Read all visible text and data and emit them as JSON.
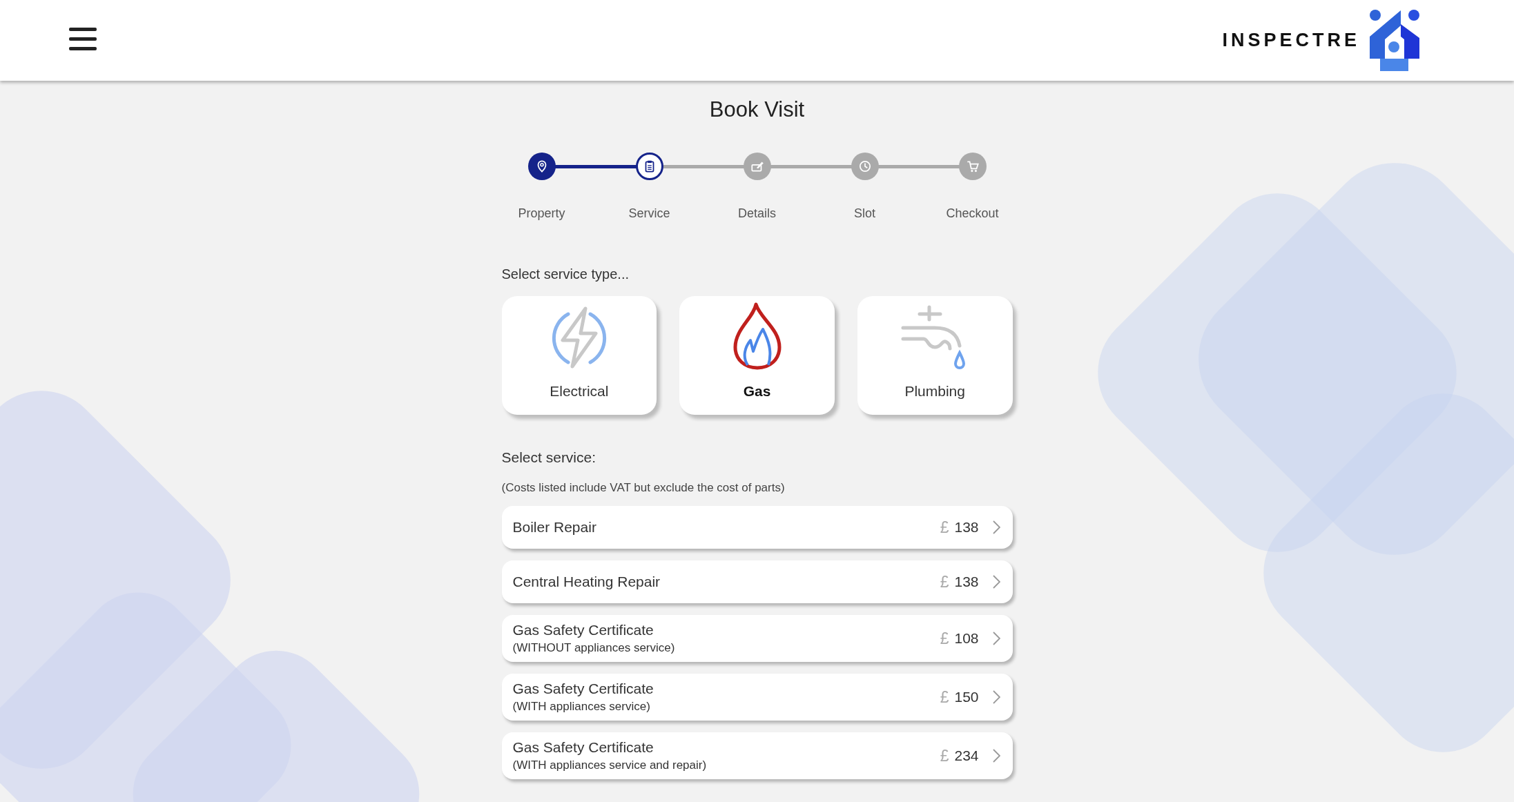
{
  "header": {
    "logo_text": "INSPECTRE"
  },
  "page_title": "Book Visit",
  "steps": [
    {
      "label": "Property",
      "completed": true,
      "selected": false
    },
    {
      "label": "Service",
      "completed": false,
      "selected": true
    },
    {
      "label": "Details",
      "completed": false,
      "selected": false
    },
    {
      "label": "Slot",
      "completed": false,
      "selected": false
    },
    {
      "label": "Checkout",
      "completed": false,
      "selected": false
    }
  ],
  "service_type": {
    "heading": "Select service type...",
    "options": [
      {
        "label": "Electrical",
        "selected": false
      },
      {
        "label": "Gas",
        "selected": true
      },
      {
        "label": "Plumbing",
        "selected": false
      }
    ]
  },
  "services": {
    "heading": "Select service:",
    "note": "(Costs listed include VAT but exclude the cost of parts)",
    "items": [
      {
        "title": "Boiler Repair",
        "currency": "£",
        "price": "138"
      },
      {
        "title": "Central Heating Repair",
        "currency": "£",
        "price": "138"
      },
      {
        "title": "Gas Safety Certificate",
        "subtitle": "(WITHOUT appliances service)",
        "currency": "£",
        "price": "108"
      },
      {
        "title": "Gas Safety Certificate",
        "subtitle": "(WITH appliances service)",
        "currency": "£",
        "price": "150"
      },
      {
        "title": "Gas Safety Certificate",
        "subtitle": "(WITH appliances service and repair)",
        "currency": "£",
        "price": "234"
      }
    ]
  }
}
